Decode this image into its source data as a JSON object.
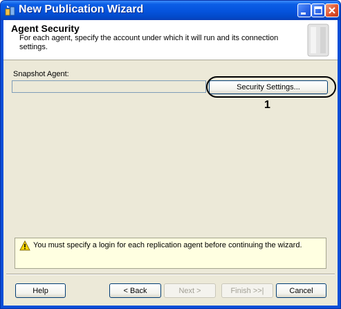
{
  "window": {
    "title": "New Publication Wizard"
  },
  "header": {
    "title": "Agent Security",
    "subtitle": "For each agent, specify the account under which it will run and its connection settings."
  },
  "snapshot": {
    "label": "Snapshot Agent:",
    "value": "",
    "security_button": "Security Settings..."
  },
  "callout": {
    "number": "1"
  },
  "message": {
    "text": "You must specify a login for each replication agent before continuing the wizard."
  },
  "footer": {
    "help": "Help",
    "back": "< Back",
    "next": "Next >",
    "finish": "Finish >>|",
    "cancel": "Cancel"
  }
}
